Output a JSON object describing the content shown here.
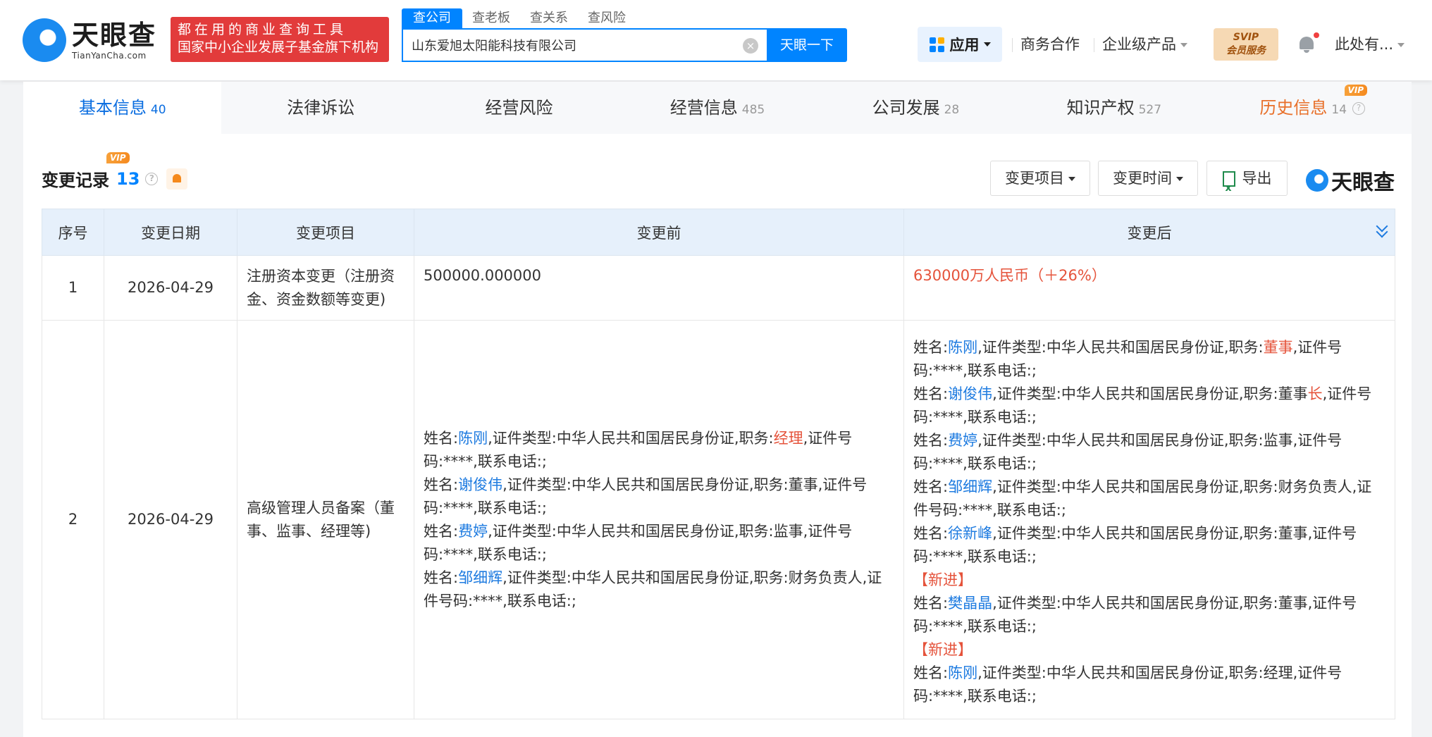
{
  "header": {
    "logo_cn": "天眼查",
    "logo_en": "TianYanCha.com",
    "slogan_line1": "都在用的商业查询工具",
    "slogan_line2": "国家中小企业发展子基金旗下机构",
    "search_tabs": [
      "查公司",
      "查老板",
      "查关系",
      "查风险"
    ],
    "search_value": "山东爱旭太阳能科技有限公司",
    "search_button": "天眼一下",
    "apps": "应用",
    "biz": "商务合作",
    "enterprise": "企业级产品",
    "svip_line1": "SVIP",
    "svip_line2": "会员服务",
    "user": "此处有..."
  },
  "tabs": [
    {
      "label": "基本信息",
      "count": "40"
    },
    {
      "label": "法律诉讼",
      "count": ""
    },
    {
      "label": "经营风险",
      "count": ""
    },
    {
      "label": "经营信息",
      "count": "485"
    },
    {
      "label": "公司发展",
      "count": "28"
    },
    {
      "label": "知识产权",
      "count": "527"
    },
    {
      "label": "历史信息",
      "count": "14"
    }
  ],
  "vip": "VIP",
  "section": {
    "title": "变更记录",
    "count": "13"
  },
  "filters": {
    "item": "变更项目",
    "time": "变更时间",
    "export": "导出"
  },
  "watermark": "天眼查",
  "table": {
    "headers": [
      "序号",
      "变更日期",
      "变更项目",
      "变更前",
      "变更后"
    ],
    "rows": [
      {
        "no": "1",
        "date": "2026-04-29",
        "item": "注册资本变更（注册资金、资金数额等变更)",
        "before": "500000.000000",
        "after": "630000万人民币（＋26%）"
      },
      {
        "no": "2",
        "date": "2026-04-29",
        "item": "高级管理人员备案（董事、监事、经理等)"
      }
    ]
  },
  "person_label": "姓名:",
  "id_label": ",证件类型:中华人民共和国居民身份证,职务:",
  "before_people": [
    {
      "name": "陈刚",
      "role": "经理",
      "tail": ",证件号码:****,联系电话:;"
    },
    {
      "name": "谢俊伟",
      "role": "董事",
      "tail": ",证件号码:****,联系电话:;"
    },
    {
      "name": "费婷",
      "role": "监事",
      "tail": ",证件号码:****,联系电话:;"
    },
    {
      "name": "邹细辉",
      "role": "财务负责人",
      "tail": ",证件号码:****,联系电话:;"
    }
  ],
  "after_people": [
    {
      "name": "陈刚",
      "role": "董事",
      "tail": ",证件号码:****,联系电话:;"
    },
    {
      "name": "谢俊伟",
      "role_a": "董事",
      "role_b": "长",
      "tail": ",证件号码:****,联系电话:;"
    },
    {
      "name": "费婷",
      "role": "监事",
      "tail": ",证件号码:****,联系电话:;"
    },
    {
      "name": "邹细辉",
      "role": "财务负责人",
      "tail": ",证件号码:****,联系电话:;"
    },
    {
      "name": "徐新峰",
      "role": "董事",
      "tail": ",证件号码:****,联系电话:;"
    },
    {
      "new": "【新进】"
    },
    {
      "name": "樊晶晶",
      "role": "董事",
      "tail": ",证件号码:****,联系电话:;"
    },
    {
      "new": "【新进】"
    },
    {
      "name": "陈刚",
      "role": "经理",
      "tail": ",证件号码:****,联系电话:;"
    }
  ]
}
